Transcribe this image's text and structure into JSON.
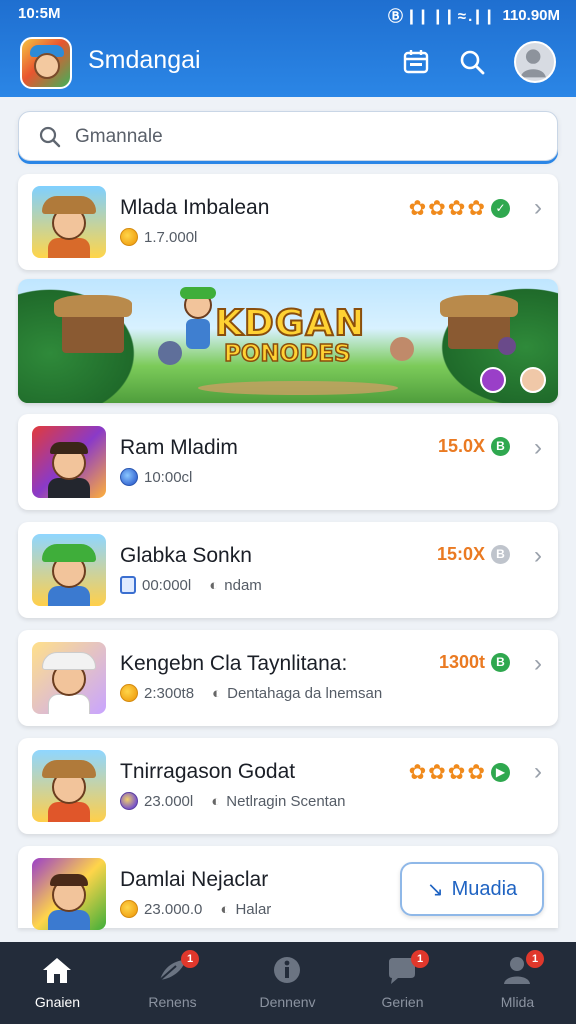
{
  "status_bar": {
    "time": "10:5M",
    "indicators": "Ⓑ ❙❙ ❙❙ ≈ .❙❙",
    "right_time": "110.90M"
  },
  "header": {
    "app_title": "Smdangai",
    "icons": [
      "calendar-icon",
      "search-icon",
      "avatar"
    ]
  },
  "search": {
    "placeholder": "Gmannale"
  },
  "list": [
    {
      "title": "Mlada Imbalean",
      "meta": "1.7.000l",
      "meta2": "",
      "rating_stars": 4,
      "rating_text": "",
      "status": "check",
      "thumb": "explorer-hat"
    },
    {
      "title": "Ram Mladim",
      "meta": "10:00cl",
      "meta2": "",
      "rating_stars": 0,
      "rating_text": "15.0X",
      "status": "B",
      "thumb": "suit"
    },
    {
      "title": "Glabka Sonkn",
      "meta": "00:000l",
      "meta2": "ndam",
      "rating_stars": 0,
      "rating_text": "15:0X",
      "status": "B",
      "thumb": "green-hat"
    },
    {
      "title": "Kengebn Cla Taynlitana:",
      "meta": "2:300t8",
      "meta2": "Dentahaga da lnemsan",
      "rating_stars": 0,
      "rating_text": "1300t",
      "status": "B",
      "thumb": "white-hair"
    },
    {
      "title": "Tnirragason Godat",
      "meta": "23.000l",
      "meta2": "Netlragin Scentan",
      "rating_stars": 4,
      "rating_text": "",
      "status": "play",
      "thumb": "explorer-hat-2"
    },
    {
      "title": "Damlai Nejaclar",
      "meta": "23.000.0",
      "meta2": "Halar",
      "rating_stars": 0,
      "rating_text": "",
      "status": "",
      "thumb": "adventurer"
    }
  ],
  "banner": {
    "line1": "KDGAN",
    "line2": "PONODES"
  },
  "last_card_button": "Muadia",
  "bottom_nav": [
    {
      "label": "Gnaien",
      "icon": "home-icon",
      "badge": "",
      "active": true
    },
    {
      "label": "Renens",
      "icon": "feather-icon",
      "badge": "1",
      "active": false
    },
    {
      "label": "Dennenv",
      "icon": "info-icon",
      "badge": "",
      "active": false
    },
    {
      "label": "Gerien",
      "icon": "chat-icon",
      "badge": "1",
      "active": false
    },
    {
      "label": "Mlida",
      "icon": "user-icon",
      "badge": "1",
      "active": false
    }
  ],
  "colors": {
    "header": "#2b86e6",
    "accent_orange": "#ea7a22",
    "success": "#2fa84f",
    "nav_bg": "#232c3a",
    "badge": "#e0382c"
  }
}
